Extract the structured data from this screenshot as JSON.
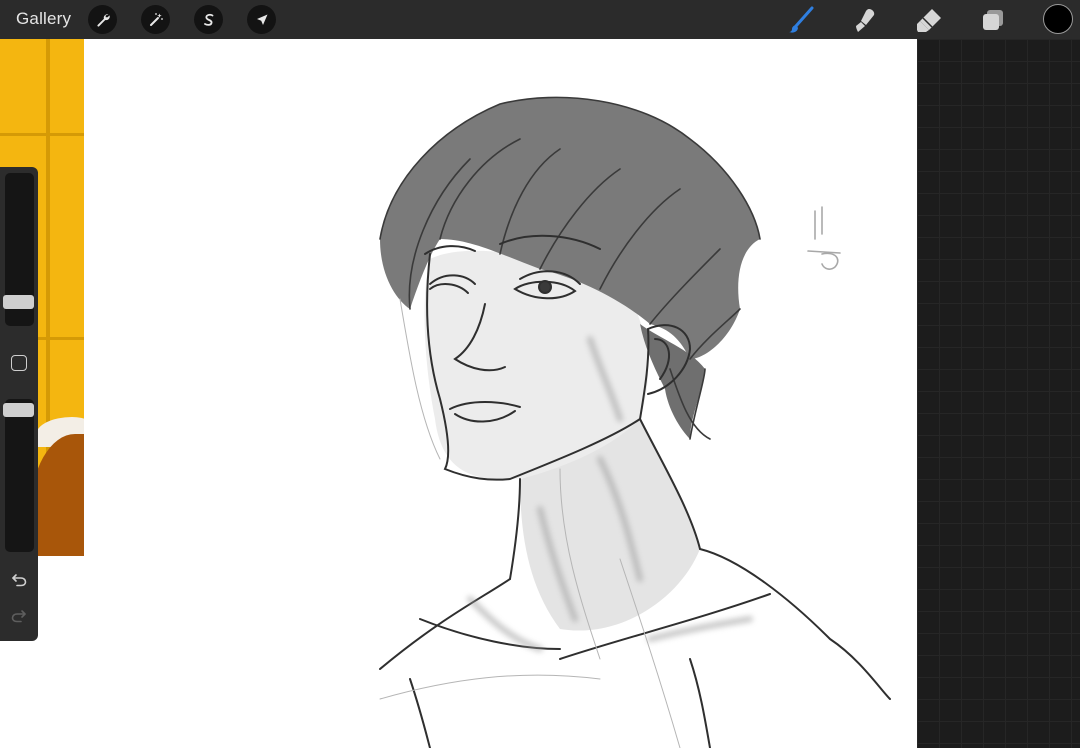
{
  "toolbar": {
    "gallery_label": "Gallery",
    "actions_icon": "wrench-icon",
    "adjustments_icon": "magic-wand-icon",
    "selection_icon": "selection-s-icon",
    "transform_icon": "arrow-cursor-icon",
    "brush_icon": "brush-icon",
    "smudge_icon": "smudge-icon",
    "eraser_icon": "eraser-icon",
    "layers_icon": "layers-icon",
    "active_tool": "brush",
    "accent_color": "#2f7fe0",
    "current_color": "#000000"
  },
  "sidebar": {
    "brush_size_level": 0.12,
    "opacity_level": 0.97,
    "modify_icon": "square-icon",
    "undo_icon": "undo-icon",
    "redo_icon": "redo-icon"
  },
  "canvas": {
    "reference_colors": {
      "background": "#f4b610",
      "grid": "#d59a06",
      "object": "#a8560a"
    },
    "sketch_stroke_color": "#3a3a3a",
    "sketch_shade_color": "#6c6c6c"
  }
}
